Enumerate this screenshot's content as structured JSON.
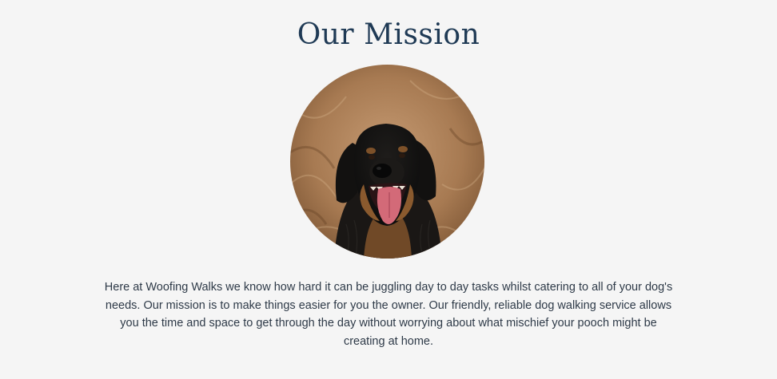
{
  "mission": {
    "heading": "Our Mission",
    "photo": {
      "subject": "dog-photo",
      "colors": {
        "background": "#a67a53",
        "fur_dark": "#141414",
        "fur_tan": "#8a5a2e",
        "tongue": "#d36a78"
      }
    },
    "text": "Here at Woofing Walks we know how hard it can be juggling day to day tasks whilst catering to all of your dog's needs. Our mission is to make things easier for you the owner. Our friendly, reliable dog walking service allows you the time and space to get through the day without worrying about what mischief your pooch might be creating at home."
  },
  "colors": {
    "page_background": "#f5f5f5",
    "heading": "#1f3a55",
    "body_text": "#2e3a48"
  }
}
